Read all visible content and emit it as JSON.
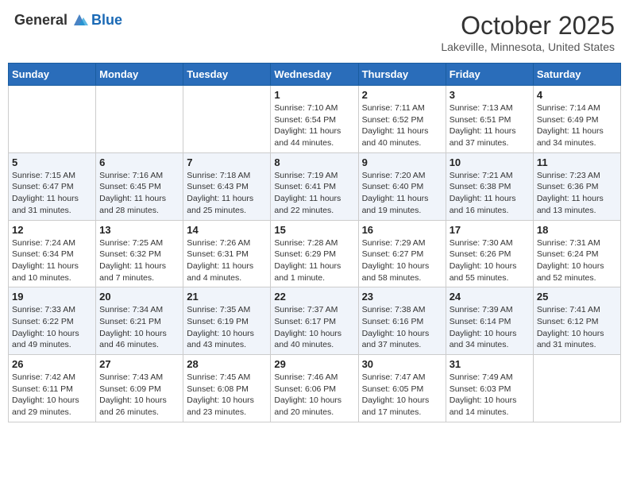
{
  "header": {
    "logo_general": "General",
    "logo_blue": "Blue",
    "title": "October 2025",
    "location": "Lakeville, Minnesota, United States"
  },
  "weekdays": [
    "Sunday",
    "Monday",
    "Tuesday",
    "Wednesday",
    "Thursday",
    "Friday",
    "Saturday"
  ],
  "weeks": [
    [
      {
        "day": "",
        "sunrise": "",
        "sunset": "",
        "daylight": ""
      },
      {
        "day": "",
        "sunrise": "",
        "sunset": "",
        "daylight": ""
      },
      {
        "day": "",
        "sunrise": "",
        "sunset": "",
        "daylight": ""
      },
      {
        "day": "1",
        "sunrise": "Sunrise: 7:10 AM",
        "sunset": "Sunset: 6:54 PM",
        "daylight": "Daylight: 11 hours and 44 minutes."
      },
      {
        "day": "2",
        "sunrise": "Sunrise: 7:11 AM",
        "sunset": "Sunset: 6:52 PM",
        "daylight": "Daylight: 11 hours and 40 minutes."
      },
      {
        "day": "3",
        "sunrise": "Sunrise: 7:13 AM",
        "sunset": "Sunset: 6:51 PM",
        "daylight": "Daylight: 11 hours and 37 minutes."
      },
      {
        "day": "4",
        "sunrise": "Sunrise: 7:14 AM",
        "sunset": "Sunset: 6:49 PM",
        "daylight": "Daylight: 11 hours and 34 minutes."
      }
    ],
    [
      {
        "day": "5",
        "sunrise": "Sunrise: 7:15 AM",
        "sunset": "Sunset: 6:47 PM",
        "daylight": "Daylight: 11 hours and 31 minutes."
      },
      {
        "day": "6",
        "sunrise": "Sunrise: 7:16 AM",
        "sunset": "Sunset: 6:45 PM",
        "daylight": "Daylight: 11 hours and 28 minutes."
      },
      {
        "day": "7",
        "sunrise": "Sunrise: 7:18 AM",
        "sunset": "Sunset: 6:43 PM",
        "daylight": "Daylight: 11 hours and 25 minutes."
      },
      {
        "day": "8",
        "sunrise": "Sunrise: 7:19 AM",
        "sunset": "Sunset: 6:41 PM",
        "daylight": "Daylight: 11 hours and 22 minutes."
      },
      {
        "day": "9",
        "sunrise": "Sunrise: 7:20 AM",
        "sunset": "Sunset: 6:40 PM",
        "daylight": "Daylight: 11 hours and 19 minutes."
      },
      {
        "day": "10",
        "sunrise": "Sunrise: 7:21 AM",
        "sunset": "Sunset: 6:38 PM",
        "daylight": "Daylight: 11 hours and 16 minutes."
      },
      {
        "day": "11",
        "sunrise": "Sunrise: 7:23 AM",
        "sunset": "Sunset: 6:36 PM",
        "daylight": "Daylight: 11 hours and 13 minutes."
      }
    ],
    [
      {
        "day": "12",
        "sunrise": "Sunrise: 7:24 AM",
        "sunset": "Sunset: 6:34 PM",
        "daylight": "Daylight: 11 hours and 10 minutes."
      },
      {
        "day": "13",
        "sunrise": "Sunrise: 7:25 AM",
        "sunset": "Sunset: 6:32 PM",
        "daylight": "Daylight: 11 hours and 7 minutes."
      },
      {
        "day": "14",
        "sunrise": "Sunrise: 7:26 AM",
        "sunset": "Sunset: 6:31 PM",
        "daylight": "Daylight: 11 hours and 4 minutes."
      },
      {
        "day": "15",
        "sunrise": "Sunrise: 7:28 AM",
        "sunset": "Sunset: 6:29 PM",
        "daylight": "Daylight: 11 hours and 1 minute."
      },
      {
        "day": "16",
        "sunrise": "Sunrise: 7:29 AM",
        "sunset": "Sunset: 6:27 PM",
        "daylight": "Daylight: 10 hours and 58 minutes."
      },
      {
        "day": "17",
        "sunrise": "Sunrise: 7:30 AM",
        "sunset": "Sunset: 6:26 PM",
        "daylight": "Daylight: 10 hours and 55 minutes."
      },
      {
        "day": "18",
        "sunrise": "Sunrise: 7:31 AM",
        "sunset": "Sunset: 6:24 PM",
        "daylight": "Daylight: 10 hours and 52 minutes."
      }
    ],
    [
      {
        "day": "19",
        "sunrise": "Sunrise: 7:33 AM",
        "sunset": "Sunset: 6:22 PM",
        "daylight": "Daylight: 10 hours and 49 minutes."
      },
      {
        "day": "20",
        "sunrise": "Sunrise: 7:34 AM",
        "sunset": "Sunset: 6:21 PM",
        "daylight": "Daylight: 10 hours and 46 minutes."
      },
      {
        "day": "21",
        "sunrise": "Sunrise: 7:35 AM",
        "sunset": "Sunset: 6:19 PM",
        "daylight": "Daylight: 10 hours and 43 minutes."
      },
      {
        "day": "22",
        "sunrise": "Sunrise: 7:37 AM",
        "sunset": "Sunset: 6:17 PM",
        "daylight": "Daylight: 10 hours and 40 minutes."
      },
      {
        "day": "23",
        "sunrise": "Sunrise: 7:38 AM",
        "sunset": "Sunset: 6:16 PM",
        "daylight": "Daylight: 10 hours and 37 minutes."
      },
      {
        "day": "24",
        "sunrise": "Sunrise: 7:39 AM",
        "sunset": "Sunset: 6:14 PM",
        "daylight": "Daylight: 10 hours and 34 minutes."
      },
      {
        "day": "25",
        "sunrise": "Sunrise: 7:41 AM",
        "sunset": "Sunset: 6:12 PM",
        "daylight": "Daylight: 10 hours and 31 minutes."
      }
    ],
    [
      {
        "day": "26",
        "sunrise": "Sunrise: 7:42 AM",
        "sunset": "Sunset: 6:11 PM",
        "daylight": "Daylight: 10 hours and 29 minutes."
      },
      {
        "day": "27",
        "sunrise": "Sunrise: 7:43 AM",
        "sunset": "Sunset: 6:09 PM",
        "daylight": "Daylight: 10 hours and 26 minutes."
      },
      {
        "day": "28",
        "sunrise": "Sunrise: 7:45 AM",
        "sunset": "Sunset: 6:08 PM",
        "daylight": "Daylight: 10 hours and 23 minutes."
      },
      {
        "day": "29",
        "sunrise": "Sunrise: 7:46 AM",
        "sunset": "Sunset: 6:06 PM",
        "daylight": "Daylight: 10 hours and 20 minutes."
      },
      {
        "day": "30",
        "sunrise": "Sunrise: 7:47 AM",
        "sunset": "Sunset: 6:05 PM",
        "daylight": "Daylight: 10 hours and 17 minutes."
      },
      {
        "day": "31",
        "sunrise": "Sunrise: 7:49 AM",
        "sunset": "Sunset: 6:03 PM",
        "daylight": "Daylight: 10 hours and 14 minutes."
      },
      {
        "day": "",
        "sunrise": "",
        "sunset": "",
        "daylight": ""
      }
    ]
  ]
}
